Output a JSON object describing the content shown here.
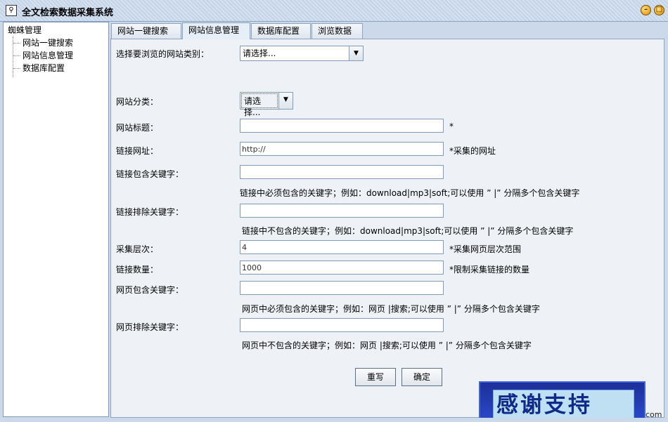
{
  "window": {
    "title": "全文检索数据采集系统"
  },
  "tree": {
    "root": "蜘蛛管理",
    "items": [
      "网站一键搜索",
      "网站信息管理",
      "数据库配置"
    ]
  },
  "tabs": [
    "网站一键搜索",
    "网站信息管理",
    "数据库配置",
    "浏览数据"
  ],
  "form": {
    "browse_category": {
      "label": "选择要浏览的网站类别：",
      "value": "请选择..."
    },
    "site_category": {
      "label": "网站分类：",
      "value": "请选择..."
    },
    "site_title": {
      "label": "网站标题：",
      "value": "",
      "hint": "*"
    },
    "link_url": {
      "label": "链接网址：",
      "value": "http://",
      "hint": "*采集的网址"
    },
    "link_include": {
      "label": "链接包含关键字：",
      "value": "",
      "hint": "链接中必须包含的关键字；例如：download|mp3|soft;可以使用 ” |” 分隔多个包含关键字"
    },
    "link_exclude": {
      "label": "链接排除关键字：",
      "value": "",
      "hint": "链接中不包含的关键字；例如：download|mp3|soft;可以使用 ” |” 分隔多个包含关键字"
    },
    "crawl_depth": {
      "label": "采集层次：",
      "value": "4",
      "hint": "*采集网页层次范围"
    },
    "link_count": {
      "label": "链接数量：",
      "value": "1000",
      "hint": "*限制采集链接的数量"
    },
    "page_include": {
      "label": "网页包含关键字：",
      "value": "",
      "hint": "网页中必须包含的关键字；例如：网页 |搜索;可以使用 ” |” 分隔多个包含关键字"
    },
    "page_exclude": {
      "label": "网页排除关键字：",
      "value": "",
      "hint": "网页中不包含的关键字；例如：网页 |搜索;可以使用 ” |” 分隔多个包含关键字"
    }
  },
  "buttons": {
    "reset": "重写",
    "confirm": "确定"
  },
  "banner": {
    "text": "感谢支持"
  },
  "watermark": "com"
}
